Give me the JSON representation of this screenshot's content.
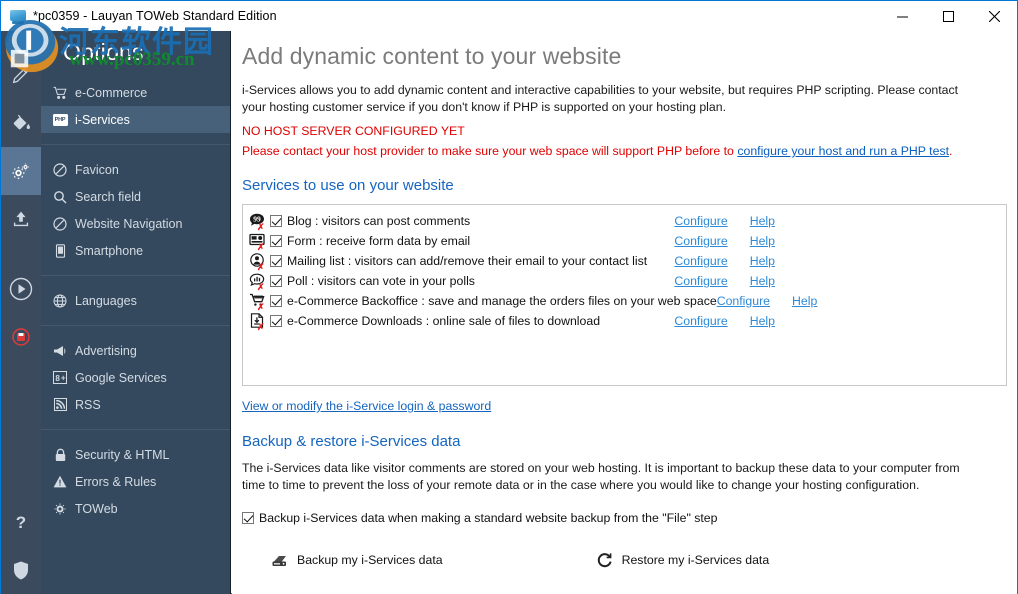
{
  "window": {
    "title": "*pc0359 - Lauyan TOWeb Standard Edition",
    "app_icon": "toweb-monitor-icon",
    "minimize_label": "Minimize",
    "maximize_label": "Maximize",
    "close_label": "Close",
    "accent_border": "#0078d7"
  },
  "watermark": {
    "chinese": "河东软件园",
    "url": "www.pc0359.cn",
    "chinese_color": "#1a6fb5",
    "url_color": "#0f8a2e"
  },
  "rail": {
    "items": [
      {
        "name": "pencil-icon",
        "label": "Content"
      },
      {
        "name": "paint-bucket-icon",
        "label": "Theme"
      },
      {
        "name": "gears-icon",
        "label": "Options",
        "active": true
      },
      {
        "name": "upload-icon",
        "label": "Publish"
      },
      {
        "name": "play-icon",
        "label": "Preview"
      },
      {
        "name": "record-icon",
        "label": "Save"
      }
    ],
    "bottom_items": [
      {
        "name": "help-icon",
        "label": "?"
      },
      {
        "name": "shield-icon",
        "label": "Security"
      }
    ],
    "background": "#3b4a5c",
    "active_background": "#5b7694"
  },
  "sidebar": {
    "title": "Options",
    "background": "#34495e",
    "selected_background": "#47617b",
    "groups": [
      {
        "items": [
          {
            "label": "e-Commerce",
            "icon": "shopping-cart-icon",
            "selected": false
          },
          {
            "label": "i-Services",
            "icon": "php-badge-icon",
            "selected": true
          }
        ]
      },
      {
        "items": [
          {
            "label": "Favicon",
            "icon": "favicon-circle-icon",
            "selected": false
          },
          {
            "label": "Search field",
            "icon": "magnifier-icon",
            "selected": false
          },
          {
            "label": "Website Navigation",
            "icon": "navigation-circle-icon",
            "selected": false
          },
          {
            "label": "Smartphone",
            "icon": "smartphone-icon",
            "selected": false
          }
        ]
      },
      {
        "items": [
          {
            "label": "Languages",
            "icon": "globe-icon",
            "selected": false
          }
        ]
      },
      {
        "items": [
          {
            "label": "Advertising",
            "icon": "megaphone-icon",
            "selected": false
          },
          {
            "label": "Google Services",
            "icon": "google-plus-icon",
            "selected": false
          },
          {
            "label": "RSS",
            "icon": "rss-icon",
            "selected": false
          }
        ]
      },
      {
        "items": [
          {
            "label": "Security & HTML",
            "icon": "lock-icon",
            "selected": false
          },
          {
            "label": "Errors & Rules",
            "icon": "warning-triangle-icon",
            "selected": false
          },
          {
            "label": "TOWeb",
            "icon": "gear-icon",
            "selected": false
          }
        ]
      }
    ]
  },
  "main": {
    "heading": "Add dynamic content to your website",
    "intro": "i-Services allows you to add dynamic content and interactive capabilities to your website, but requires PHP scripting. Please contact your hosting customer service if you don't know if PHP is supported on your hosting plan.",
    "warning_line1": "NO HOST SERVER CONFIGURED YET",
    "warning_line2_prefix": "Please contact your host provider to make sure your web space will support PHP before to ",
    "warning_link": "configure your host and run a PHP test",
    "warning_line2_suffix": ".",
    "services_heading": "Services to use on your website",
    "services": [
      {
        "icon": "blog-comment-icon",
        "checked": true,
        "label": "Blog : visitors can post comments",
        "configure": "Configure",
        "help": "Help",
        "status_badge": "error-x"
      },
      {
        "icon": "form-icon",
        "checked": true,
        "label": "Form : receive form data by email",
        "configure": "Configure",
        "help": "Help",
        "status_badge": "error-x"
      },
      {
        "icon": "mailing-list-icon",
        "checked": true,
        "label": "Mailing list : visitors can add/remove their email to your contact list",
        "configure": "Configure",
        "help": "Help",
        "status_badge": "error-x"
      },
      {
        "icon": "poll-icon",
        "checked": true,
        "label": "Poll : visitors can vote in your polls",
        "configure": "Configure",
        "help": "Help",
        "status_badge": "error-x"
      },
      {
        "icon": "backoffice-cart-icon",
        "checked": true,
        "label": "e-Commerce Backoffice : save and manage the orders files on your web space",
        "configure": "Configure",
        "help": "Help",
        "status_badge": "error-x"
      },
      {
        "icon": "download-file-icon",
        "checked": true,
        "label": "e-Commerce Downloads : online sale of files to download",
        "configure": "Configure",
        "help": "Help",
        "status_badge": "error-x"
      }
    ],
    "login_link": "View or modify the i-Service login & password",
    "backup_heading": "Backup & restore i-Services data",
    "backup_intro": "The i-Services data like visitor comments are stored on your web hosting. It is important to backup these data to your computer from time to time to prevent the loss of your remote data or in the case where you would like to change your hosting configuration.",
    "backup_checkbox_label": "Backup i-Services data when making a standard website backup from the \"File\" step",
    "backup_checkbox_checked": true,
    "backup_button": "Backup my i-Services data",
    "restore_button": "Restore my i-Services data",
    "link_color": "#2e8bd8",
    "heading_color": "#1565c0",
    "warning_color": "#e00000"
  }
}
